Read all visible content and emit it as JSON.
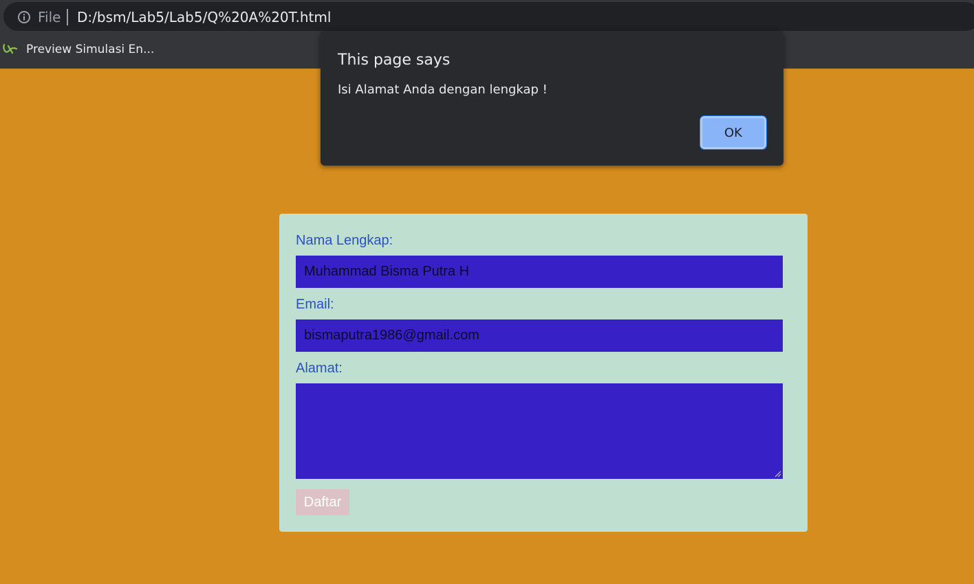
{
  "browser": {
    "scheme_label": "File",
    "url": "D:/bsm/Lab5/Lab5/Q%20A%20T.html",
    "bookmark_label": "Preview Simulasi En..."
  },
  "form": {
    "name_label": "Nama Lengkap:",
    "name_value": "Muhammad Bisma Putra H",
    "email_label": "Email:",
    "email_value": "bismaputra1986@gmail.com",
    "address_label": "Alamat:",
    "address_value": "",
    "submit_label": "Daftar"
  },
  "dialog": {
    "title": "This page says",
    "message": "Isi Alamat Anda dengan lengkap !",
    "ok_label": "OK"
  },
  "colors": {
    "page_background": "#d68d1f",
    "card_background": "#bfe0d1",
    "field_background": "#3720c6",
    "label_text": "#2b4fc9",
    "button_background": "#dcc2c6",
    "dialog_background": "#292a2d",
    "dialog_button": "#8ab4f8"
  },
  "icons": {
    "info": "info-icon",
    "bookmark": "bookmark-favicon-icon",
    "resize": "resize-grip-icon"
  }
}
